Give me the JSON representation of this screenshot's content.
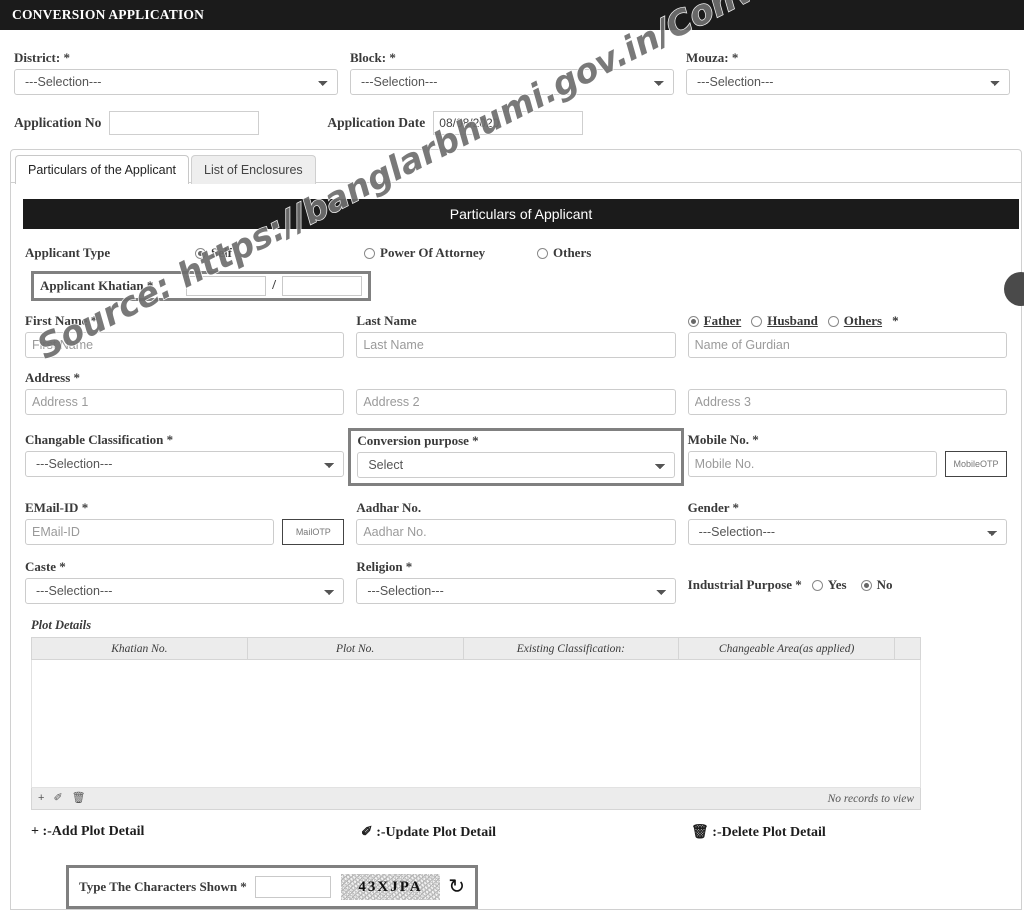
{
  "header": {
    "title": "CONVERSION APPLICATION"
  },
  "top_filters": {
    "district": {
      "label": "District: *",
      "value": "---Selection---"
    },
    "block": {
      "label": "Block: *",
      "value": "---Selection---"
    },
    "mouza": {
      "label": "Mouza: *",
      "value": "---Selection---"
    }
  },
  "application": {
    "no_label": "Application No",
    "no_value": "",
    "date_label": "Application Date",
    "date_value": "08/08/2020"
  },
  "tabs": [
    {
      "label": "Particulars of the Applicant",
      "active": true
    },
    {
      "label": "List of Enclosures",
      "active": false
    }
  ],
  "section": {
    "banner": "Particulars of Applicant"
  },
  "applicant_type": {
    "label": "Applicant Type",
    "options": [
      {
        "label": "Self",
        "selected": true
      },
      {
        "label": "Power Of Attorney",
        "selected": false
      },
      {
        "label": "Others",
        "selected": false
      }
    ]
  },
  "khatian": {
    "label": "Applicant Khatian *",
    "value_1": "",
    "separator": "/",
    "value_2": ""
  },
  "name_row": {
    "first_name_label": "First Name *",
    "first_name_placeholder": "First Name",
    "first_name_value": "",
    "last_name_label": "Last Name",
    "last_name_placeholder": "Last Name",
    "last_name_value": "",
    "guardian_options": [
      {
        "label": "Father",
        "selected": true
      },
      {
        "label": "Husband",
        "selected": false
      },
      {
        "label": "Others",
        "selected": false
      }
    ],
    "guardian_star": "*",
    "guardian_placeholder": "Name of Gurdian",
    "guardian_value": ""
  },
  "address_row": {
    "label": "Address *",
    "address1_placeholder": "Address 1",
    "address2_placeholder": "Address 2",
    "address3_placeholder": "Address 3",
    "address1_value": "",
    "address2_value": "",
    "address3_value": ""
  },
  "classification_row": {
    "changable_label": "Changable Classification *",
    "changable_value": "---Selection---",
    "conversion_label": "Conversion purpose *",
    "conversion_value": "Select",
    "mobile_label": "Mobile No. *",
    "mobile_placeholder": "Mobile No.",
    "mobile_value": "",
    "mobile_otp_button": "MobileOTP"
  },
  "contact_row": {
    "email_label": "EMail-ID *",
    "email_placeholder": "EMail-ID",
    "email_value": "",
    "email_otp_button": "MailOTP",
    "aadhar_label": "Aadhar No.",
    "aadhar_placeholder": "Aadhar No.",
    "aadhar_value": "",
    "gender_label": "Gender *",
    "gender_value": "---Selection---"
  },
  "caste_row": {
    "caste_label": "Caste *",
    "caste_value": "---Selection---",
    "religion_label": "Religion *",
    "religion_value": "---Selection---",
    "industrial_label": "Industrial Purpose *",
    "industrial_options": [
      {
        "label": "Yes",
        "selected": false
      },
      {
        "label": "No",
        "selected": true
      }
    ]
  },
  "plot_details": {
    "title": "Plot Details",
    "columns": [
      "Khatian No.",
      "Plot No.",
      "Existing Classification:",
      "Changeable Area(as applied)"
    ],
    "rows": [],
    "empty_text": "No records to view",
    "footer_icons": [
      {
        "name": "add-icon",
        "glyph": "+"
      },
      {
        "name": "edit-icon",
        "glyph": "✐"
      },
      {
        "name": "delete-icon",
        "glyph": "🗑"
      }
    ]
  },
  "legend": [
    {
      "icon": "+",
      "text": ":-Add Plot Detail"
    },
    {
      "icon": "✐",
      "text": ":-Update Plot Detail"
    },
    {
      "icon": "🗑",
      "text": ":-Delete Plot Detail"
    }
  ],
  "captcha": {
    "label": "Type The Characters Shown *",
    "input_value": "",
    "code": "43XJPA",
    "refresh_icon": "refresh-icon"
  },
  "watermark": {
    "text": "Source: https://banglarbhumi.gov.in/ConvAppViewAction.action"
  },
  "colors": {
    "header_bg": "#1b1b1b",
    "highlight_border": "#808080",
    "table_header_bg": "#ececec"
  }
}
